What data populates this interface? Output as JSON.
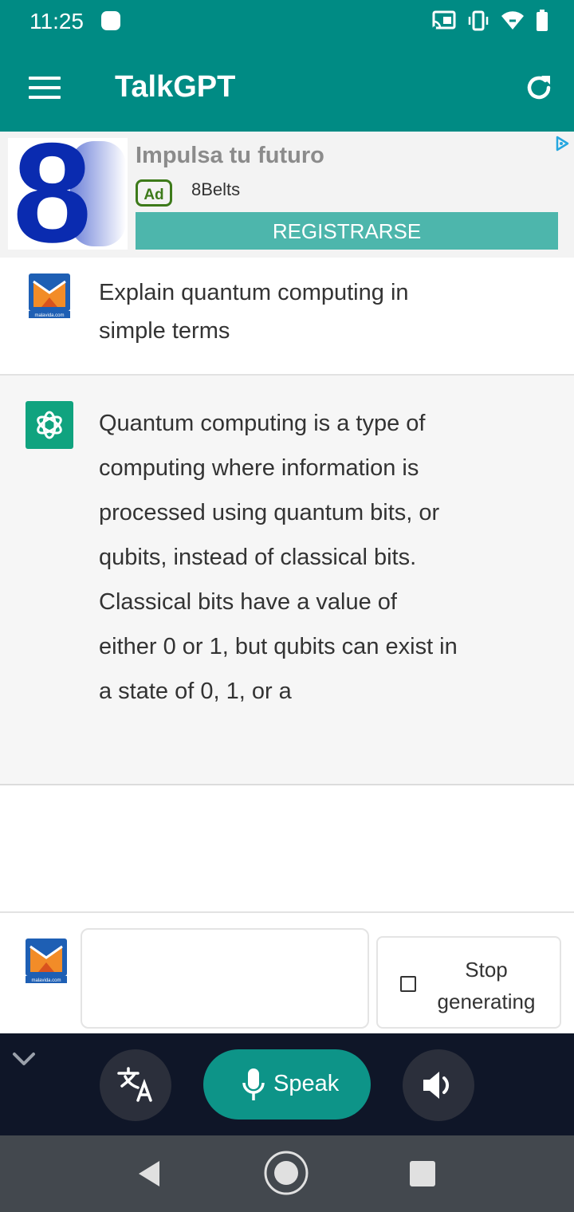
{
  "status_bar": {
    "time": "11:25"
  },
  "app_bar": {
    "title": "TalkGPT"
  },
  "ad": {
    "headline": "Impulsa tu futuro",
    "badge": "Ad",
    "advertiser": "8Belts",
    "cta": "REGISTRARSE",
    "logo_text": "8"
  },
  "conversation": {
    "user_message": "Explain quantum computing in simple terms",
    "bot_message": "Quantum computing is a type of computing where information is processed using quantum bits, or qubits, instead of classical bits. Classical bits have a value of either 0 or 1, but qubits can exist in a state of 0, 1, or a"
  },
  "input": {
    "value": "",
    "placeholder": ""
  },
  "stop_button": {
    "label": "Stop generating"
  },
  "voice_bar": {
    "speak_label": "Speak"
  },
  "icons": {
    "menu": "menu-icon",
    "refresh": "refresh-icon",
    "mic": "microphone-icon",
    "translate": "translate-icon",
    "volume": "volume-icon",
    "collapse": "chevron-down-icon"
  },
  "colors": {
    "primary": "#008b84",
    "ad_cta": "#4db6ac",
    "bot_avatar": "#10a37f",
    "voice_bar": "#0f1628",
    "speak_button": "#0d9488",
    "nav_bar": "#43484e"
  }
}
